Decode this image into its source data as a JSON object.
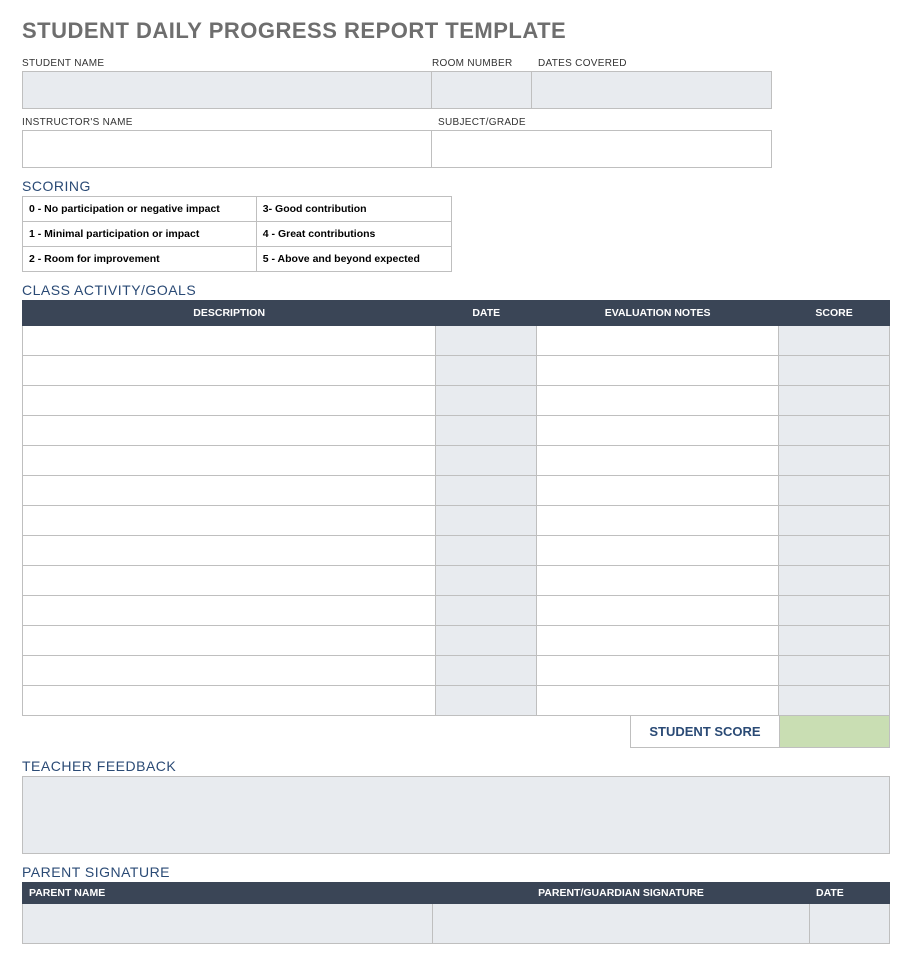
{
  "title": "STUDENT DAILY PROGRESS REPORT TEMPLATE",
  "info_row1": {
    "student_name_label": "STUDENT NAME",
    "room_number_label": "ROOM NUMBER",
    "dates_covered_label": "DATES COVERED"
  },
  "info_row2": {
    "instructor_label": "INSTRUCTOR'S NAME",
    "subject_label": "SUBJECT/GRADE"
  },
  "scoring": {
    "heading": "SCORING",
    "items": [
      [
        "0 - No participation or negative impact",
        "3- Good contribution"
      ],
      [
        "1 - Minimal participation or impact",
        "4 - Great contributions"
      ],
      [
        "2 - Room for improvement",
        "5 - Above and beyond expected"
      ]
    ]
  },
  "activity": {
    "heading": "CLASS ACTIVITY/GOALS",
    "columns": {
      "description": "DESCRIPTION",
      "date": "DATE",
      "notes": "EVALUATION NOTES",
      "score": "SCORE"
    },
    "row_count": 13,
    "student_score_label": "STUDENT SCORE"
  },
  "feedback": {
    "heading": "TEACHER FEEDBACK"
  },
  "parent": {
    "heading": "PARENT SIGNATURE",
    "columns": {
      "name": "PARENT NAME",
      "signature": "PARENT/GUARDIAN SIGNATURE",
      "date": "DATE"
    }
  }
}
